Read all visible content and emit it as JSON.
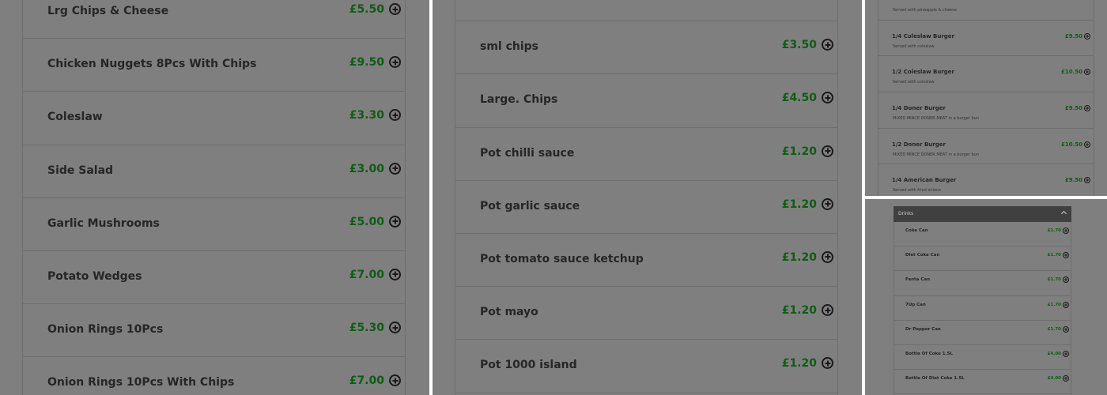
{
  "panel1": {
    "items": [
      {
        "name": "Lrg Chips & Cheese",
        "price": "£5.50"
      },
      {
        "name": "Chicken Nuggets 8Pcs With Chips",
        "price": "£9.50"
      },
      {
        "name": "Coleslaw",
        "price": "£3.30"
      },
      {
        "name": "Side Salad",
        "price": "£3.00"
      },
      {
        "name": "Garlic Mushrooms",
        "price": "£5.00"
      },
      {
        "name": "Potato Wedges",
        "price": "£7.00"
      },
      {
        "name": "Onion Rings 10Pcs",
        "price": "£5.30"
      },
      {
        "name": "Onion Rings 10Pcs With Chips",
        "price": "£7.00"
      }
    ]
  },
  "panel2": {
    "items": [
      {
        "name": "",
        "price": ""
      },
      {
        "name": "sml chips",
        "price": "£3.50"
      },
      {
        "name": "Large. Chips",
        "price": "£4.50"
      },
      {
        "name": "Pot chilli sauce",
        "price": "£1.20"
      },
      {
        "name": "Pot garlic sauce",
        "price": "£1.20"
      },
      {
        "name": "Pot tomato sauce ketchup",
        "price": "£1.20"
      },
      {
        "name": "Pot mayo",
        "price": "£1.20"
      },
      {
        "name": "Pot 1000 island",
        "price": "£1.20"
      }
    ]
  },
  "panel3": {
    "items": [
      {
        "name": "",
        "desc": "Served with pineapple & cheese",
        "price": ""
      },
      {
        "name": "1/4 Coleslaw Burger",
        "desc": "Served with coleslaw",
        "price": "£9.50"
      },
      {
        "name": "1/2 Coleslaw Burger",
        "desc": "Served with coleslaw",
        "price": "£10.50"
      },
      {
        "name": "1/4 Doner Burger",
        "desc": "MIXED MINCE DONER MEAT in a burger bun",
        "price": "£9.50"
      },
      {
        "name": "1/2 Doner Burger",
        "desc": "MIXED MINCE DONER MEAT in a burger bun",
        "price": "£10.50"
      },
      {
        "name": "1/4 American Burger",
        "desc": "Served with fried onions",
        "price": "£9.50"
      }
    ]
  },
  "panel4": {
    "category": "Drinks",
    "items": [
      {
        "name": "Coke Can",
        "price": "£1.70"
      },
      {
        "name": "Diet Coke Can",
        "price": "£1.70"
      },
      {
        "name": "Fanta Can",
        "price": "£1.70"
      },
      {
        "name": "7Up Can",
        "price": "£1.70"
      },
      {
        "name": "Dr Pepper Can",
        "price": "£1.70"
      },
      {
        "name": "Bottle Of Coke 1.5L",
        "price": "£4.00"
      },
      {
        "name": "Bottle Of Diet Coke 1.5L",
        "price": "£4.00"
      }
    ]
  },
  "colors": {
    "overlay": "#7f7f7f",
    "price": "#0d5e12",
    "text": "#262626"
  },
  "icons": {
    "add": "plus-circle-icon",
    "collapse": "chevron-up-icon"
  }
}
